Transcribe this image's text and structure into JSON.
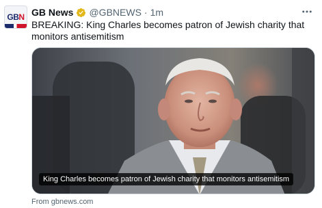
{
  "tweet": {
    "author_name": "GB News",
    "author_handle": "@GBNEWS",
    "separator": "·",
    "time": "1m",
    "text": "BREAKING: King Charles becomes patron of Jewish charity that monitors antisemitism",
    "more_icon": "more-horizontal-icon",
    "verified_icon": "verified-badge-icon",
    "verified_color": "#e2b719"
  },
  "avatar": {
    "logo_text_main": "GB",
    "logo_text_accent": "N",
    "brand_colors": {
      "navy": "#1b2a6b",
      "red": "#d0142c"
    }
  },
  "card": {
    "image": "photo of King Charles in grey suit",
    "caption": "King Charles becomes patron of Jewish charity that monitors antisemitism",
    "source": "From gbnews.com"
  }
}
